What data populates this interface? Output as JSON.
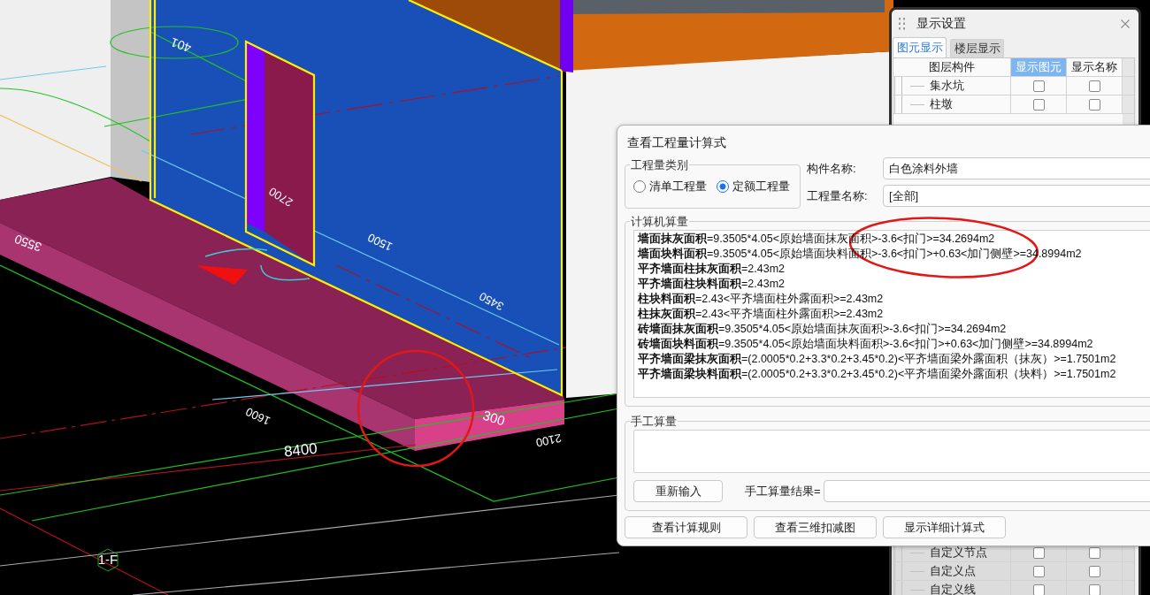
{
  "viewport": {
    "dimension_labels": [
      "401",
      "3550",
      "2700",
      "1500",
      "3450",
      "1600",
      "300",
      "8400",
      "2100"
    ],
    "axis_label": "1-F"
  },
  "display_panel": {
    "title": "显示设置",
    "tabs": [
      {
        "label": "图元显示",
        "selected": true
      },
      {
        "label": "楼层显示",
        "selected": false
      }
    ],
    "columns": [
      {
        "label": "图层构件",
        "selected": false
      },
      {
        "label": "显示图元",
        "selected": true
      },
      {
        "label": "显示名称",
        "selected": false
      }
    ],
    "rows_top": [
      {
        "name": "集水坑",
        "checks": [
          {
            "checked": false
          },
          {
            "checked": false
          }
        ]
      },
      {
        "name": "柱墩",
        "checks": [
          {
            "checked": false
          },
          {
            "checked": false
          }
        ]
      }
    ],
    "rows_bottom": [
      {
        "name": "自定义节点",
        "checks": [
          {
            "checked": false
          },
          {
            "checked": false
          }
        ]
      },
      {
        "name": "自定义点",
        "checks": [
          {
            "checked": false
          },
          {
            "checked": false
          }
        ]
      },
      {
        "name": "自定义线",
        "checks": [
          {
            "checked": false
          },
          {
            "checked": false
          }
        ]
      }
    ]
  },
  "dialog": {
    "title": "查看工程量计算式",
    "category": {
      "legend": "工程量类别",
      "options": [
        {
          "label": "清单工程量",
          "selected": false
        },
        {
          "label": "定额工程量",
          "selected": true
        }
      ]
    },
    "fields": [
      {
        "label": "构件名称:",
        "value": "白色涂料外墙"
      },
      {
        "label": "工程量名称:",
        "value": "[全部]"
      }
    ],
    "computed": {
      "legend": "计算机算量",
      "formulas": [
        {
          "label": "墙面抹灰面积",
          "expression": "=9.3505*4.05<原始墙面抹灰面积>-3.6<扣门>=34.2694m2"
        },
        {
          "label": "墙面块料面积",
          "expression": "=9.3505*4.05<原始墙面块料面积>-3.6<扣门>+0.63<加门侧壁>=34.8994m2"
        },
        {
          "label": "平齐墙面柱抹灰面积",
          "expression": "=2.43m2"
        },
        {
          "label": "平齐墙面柱块料面积",
          "expression": "=2.43m2"
        },
        {
          "label": "柱块料面积",
          "expression": "=2.43<平齐墙面柱外露面积>=2.43m2"
        },
        {
          "label": "柱抹灰面积",
          "expression": "=2.43<平齐墙面柱外露面积>=2.43m2"
        },
        {
          "label": "砖墙面抹灰面积",
          "expression": "=9.3505*4.05<原始墙面抹灰面积>-3.6<扣门>=34.2694m2"
        },
        {
          "label": "砖墙面块料面积",
          "expression": "=9.3505*4.05<原始墙面块料面积>-3.6<扣门>+0.63<加门侧壁>=34.8994m2"
        },
        {
          "label": "平齐墙面梁抹灰面积",
          "expression": "=(2.0005*0.2+3.3*0.2+3.45*0.2)<平齐墙面梁外露面积（抹灰）>=1.7501m2"
        },
        {
          "label": "平齐墙面梁块料面积",
          "expression": "=(2.0005*0.2+3.3*0.2+3.45*0.2)<平齐墙面梁外露面积（块料）>=1.7501m2"
        }
      ]
    },
    "manual": {
      "legend": "手工算量",
      "reenter_button": "重新输入",
      "result_label": "手工算量结果="
    },
    "buttons": [
      "查看计算规则",
      "查看三维扣减图",
      "显示详细计算式"
    ]
  }
}
